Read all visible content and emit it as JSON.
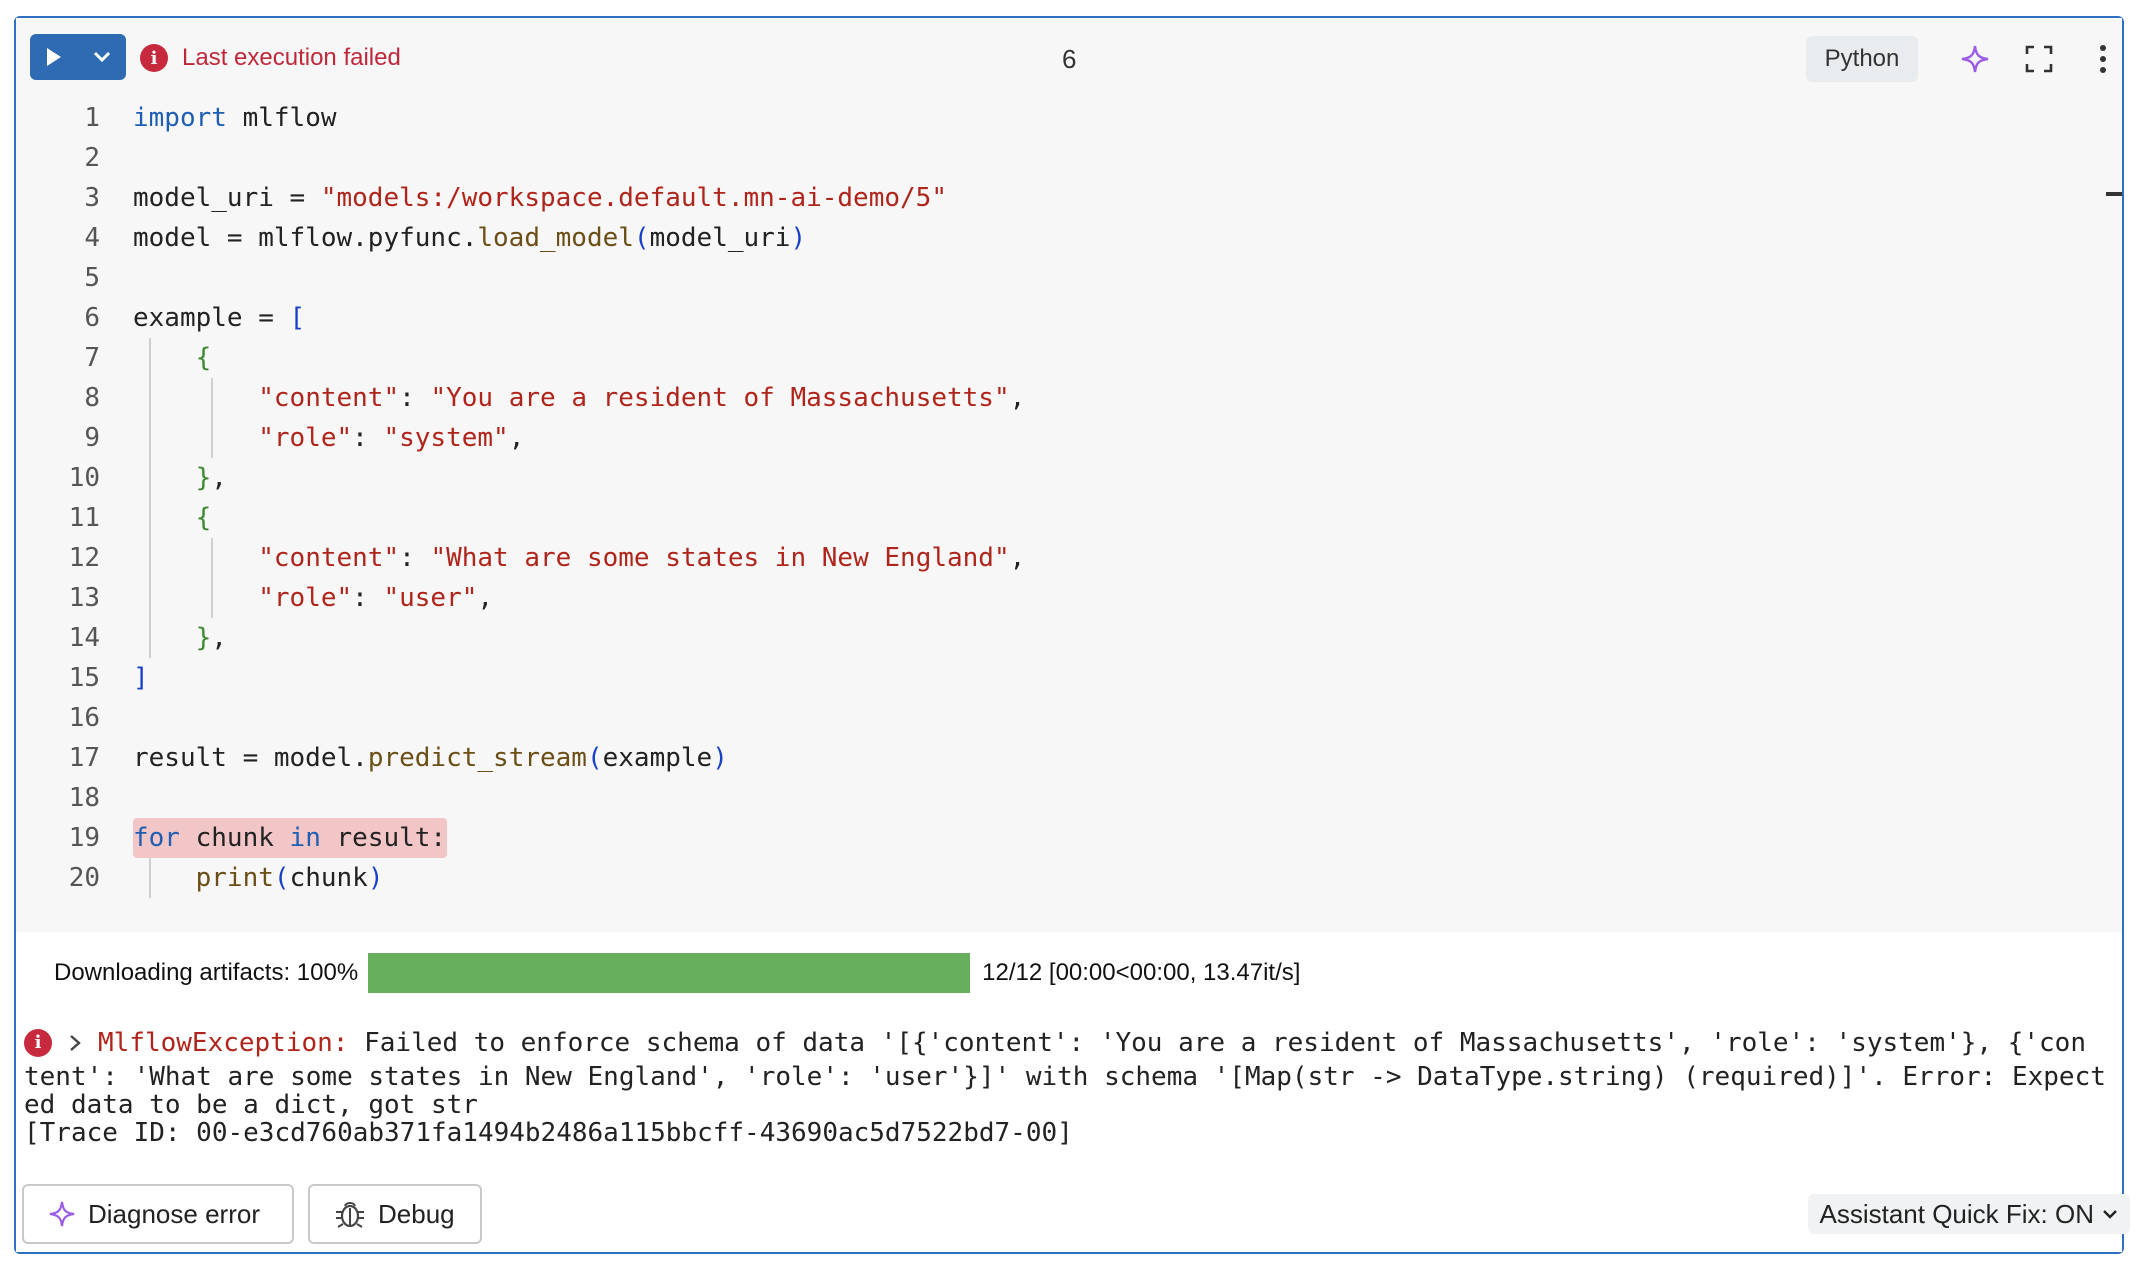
{
  "header": {
    "run_button": {
      "play_icon": "play-icon",
      "dropdown_icon": "chevron-down-icon"
    },
    "status_text": "Last execution failed",
    "cell_number": "6",
    "language": "Python",
    "icons": [
      "sparkle-icon",
      "expand-icon",
      "more-vertical-icon"
    ]
  },
  "code": {
    "line_numbers": [
      "1",
      "2",
      "3",
      "4",
      "5",
      "6",
      "7",
      "8",
      "9",
      "10",
      "11",
      "12",
      "13",
      "14",
      "15",
      "16",
      "17",
      "18",
      "19",
      "20"
    ],
    "lines": [
      "import mlflow",
      "",
      "model_uri = \"models:/workspace.default.mn-ai-demo/5\"",
      "model = mlflow.pyfunc.load_model(model_uri)",
      "",
      "example = [",
      "    {",
      "        \"content\": \"You are a resident of Massachusetts\",",
      "        \"role\": \"system\",",
      "    },",
      "    {",
      "        \"content\": \"What are some states in New England\",",
      "        \"role\": \"user\",",
      "    },",
      "]",
      "",
      "result = model.predict_stream(example)",
      "",
      "for chunk in result:",
      "    print(chunk)"
    ],
    "error_line": 19
  },
  "output": {
    "progress_label": "Downloading artifacts: 100%",
    "progress_value": 1.0,
    "progress_stats": "12/12 [00:00<00:00, 13.47it/s]",
    "exception_name": "MlflowException:",
    "exception_lines": [
      " Failed to enforce schema of data '[{'content': 'You are a resident of Massachusetts', 'role': 'system'}, {'con",
      "tent': 'What are some states in New England', 'role': 'user'}]' with schema '[Map(str -> DataType.string) (required)]'. Error: Expect",
      "ed data to be a dict, got str",
      "[Trace ID: 00-e3cd760ab371fa1494b2486a115bbcff-43690ac5d7522bd7-00]"
    ]
  },
  "actions": {
    "diagnose_label": "Diagnose error",
    "debug_label": "Debug",
    "quick_fix_label": "Assistant Quick Fix: ON"
  }
}
